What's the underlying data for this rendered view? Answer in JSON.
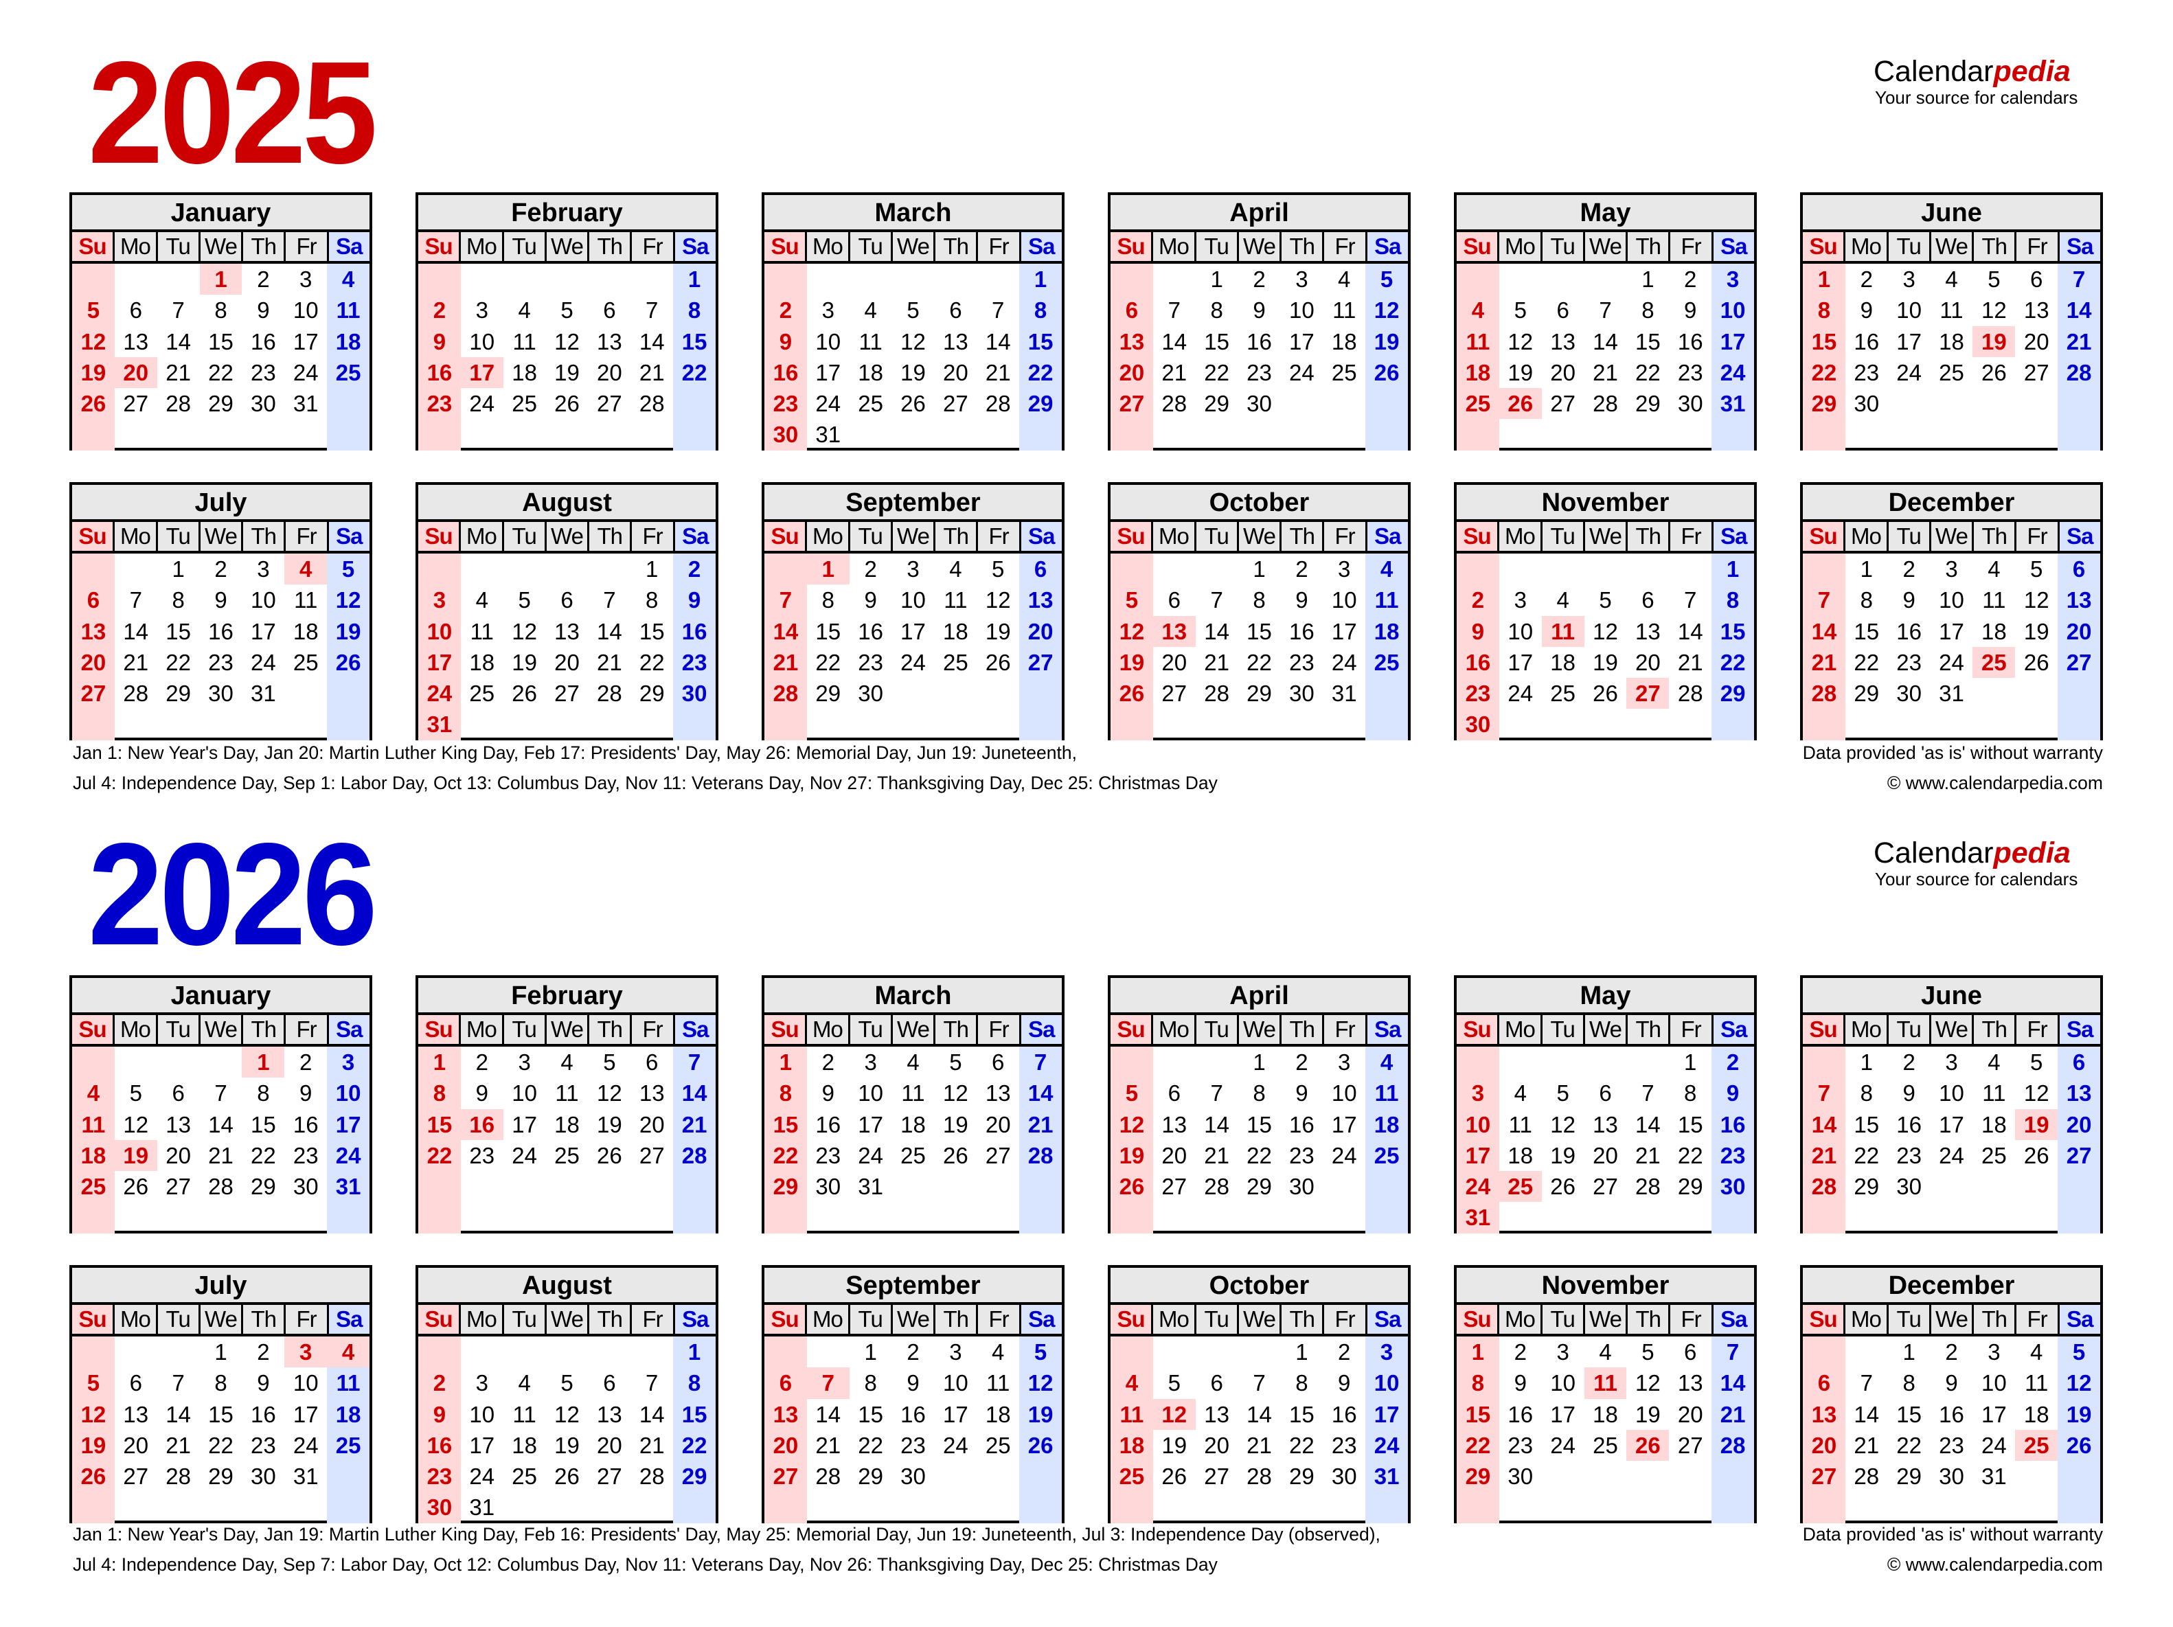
{
  "brand": {
    "name_main": "Calendar",
    "name_accent": "pedia",
    "tagline": "Your source for calendars"
  },
  "weekday_labels": [
    "Su",
    "Mo",
    "Tu",
    "We",
    "Th",
    "Fr",
    "Sa"
  ],
  "month_names": [
    "January",
    "February",
    "March",
    "April",
    "May",
    "June",
    "July",
    "August",
    "September",
    "October",
    "November",
    "December"
  ],
  "colors": {
    "year_2025": "#cc0000",
    "year_2026": "#0000cc",
    "sunday_text": "#cc0000",
    "saturday_text": "#0000cc",
    "sunday_bg": "#ffd9d9",
    "saturday_bg": "#d9e5ff",
    "holiday_bg": "#ffd9d9",
    "header_bg": "#e8e8e8"
  },
  "years": [
    {
      "year": "2025",
      "first_weekday": [
        3,
        6,
        6,
        2,
        4,
        0,
        2,
        5,
        1,
        3,
        6,
        1
      ],
      "days_in_month": [
        31,
        28,
        31,
        30,
        31,
        30,
        31,
        31,
        30,
        31,
        30,
        31
      ],
      "holidays": [
        [
          1,
          20
        ],
        [
          17
        ],
        [],
        [],
        [
          26
        ],
        [
          19
        ],
        [
          4
        ],
        [],
        [
          1
        ],
        [
          13
        ],
        [
          11,
          27
        ],
        [
          25
        ]
      ],
      "notes_line1": "Jan 1: New Year's Day, Jan 20: Martin Luther King Day, Feb 17: Presidents' Day, May 26: Memorial Day, Jun 19: Juneteenth,",
      "notes_line2": "Jul 4: Independence Day, Sep 1: Labor Day, Oct 13: Columbus Day, Nov 11: Veterans Day, Nov 27: Thanksgiving Day, Dec 25: Christmas Day",
      "disclaimer": "Data provided 'as is' without warranty",
      "copyright": "© www.calendarpedia.com"
    },
    {
      "year": "2026",
      "first_weekday": [
        4,
        0,
        0,
        3,
        5,
        1,
        3,
        6,
        2,
        4,
        0,
        2
      ],
      "days_in_month": [
        31,
        28,
        31,
        30,
        31,
        30,
        31,
        31,
        30,
        31,
        30,
        31
      ],
      "holidays": [
        [
          1,
          19
        ],
        [
          16
        ],
        [],
        [],
        [
          25
        ],
        [
          19
        ],
        [
          3,
          4
        ],
        [],
        [
          7
        ],
        [
          12
        ],
        [
          11,
          26
        ],
        [
          25
        ]
      ],
      "notes_line1": "Jan 1: New Year's Day, Jan 19: Martin Luther King Day, Feb 16: Presidents' Day, May 25: Memorial Day, Jun 19: Juneteenth, Jul 3: Independence Day (observed),",
      "notes_line2": "Jul 4: Independence Day, Sep 7: Labor Day, Oct 12: Columbus Day, Nov 11: Veterans Day, Nov 26: Thanksgiving Day, Dec 25: Christmas Day",
      "disclaimer": "Data provided 'as is' without warranty",
      "copyright": "© www.calendarpedia.com"
    }
  ]
}
